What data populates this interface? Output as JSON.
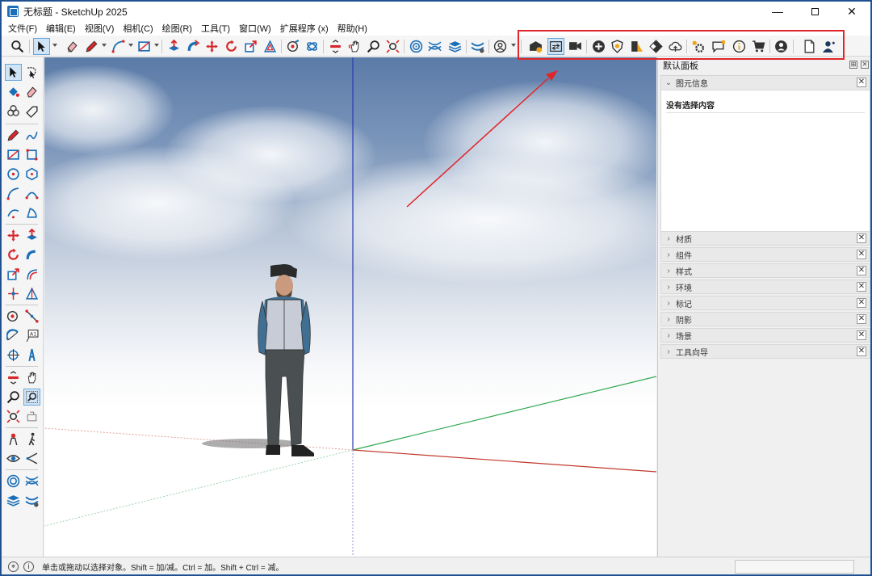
{
  "window": {
    "title": "无标题 - SketchUp 2025",
    "minimize_glyph": "—",
    "close_glyph": "✕"
  },
  "menu": [
    "文件(F)",
    "编辑(E)",
    "视图(V)",
    "相机(C)",
    "绘图(R)",
    "工具(T)",
    "窗口(W)",
    "扩展程序 (x)",
    "帮助(H)"
  ],
  "toolbar_icons": [
    "search-icon",
    "select-icon",
    "eraser-icon",
    "pencil-icon",
    "arc-icon",
    "rectangle-icon",
    "pushpull-icon",
    "followme-icon",
    "move-icon",
    "rotate-icon",
    "scale-icon",
    "offset-icon",
    "paint-icon",
    "orbit-icon",
    "section-icon",
    "pan-icon",
    "zoom-icon",
    "zoom-extents-icon",
    "layers-icon",
    "sandbox-icon",
    "stack-icon",
    "solid-icon",
    "account-icon",
    "warehouse-icon",
    "share-icon",
    "camera-export-icon",
    "add-icon",
    "shield-icon",
    "ruler-icon",
    "checker-icon",
    "cloud-icon",
    "extension-settings-icon",
    "chat-icon",
    "info-icon",
    "cart-icon",
    "profile-icon",
    "document-icon",
    "user-icon"
  ],
  "panel": {
    "title": "默认面板",
    "pin_glyph": "⊞",
    "close_glyph": "✕",
    "entity_info": {
      "label": "图元信息",
      "message": "没有选择内容"
    },
    "trays": [
      "材质",
      "组件",
      "样式",
      "环境",
      "标记",
      "阴影",
      "场景",
      "工具向导"
    ],
    "tray_close_glyph": "✕",
    "chevron_right": "›",
    "chevron_down": "⌄"
  },
  "status": {
    "hint": "单击或拖动以选择对象。Shift = 加/减。Ctrl = 加。Shift + Ctrl = 减。",
    "geo_icon": "⌖",
    "info_icon": "i"
  },
  "colors": {
    "accent": "#1b6fb8",
    "highlight": "#e0262a",
    "axis_red": "#c0392b",
    "axis_green": "#2fa84f",
    "axis_blue": "#2b3bb5"
  }
}
